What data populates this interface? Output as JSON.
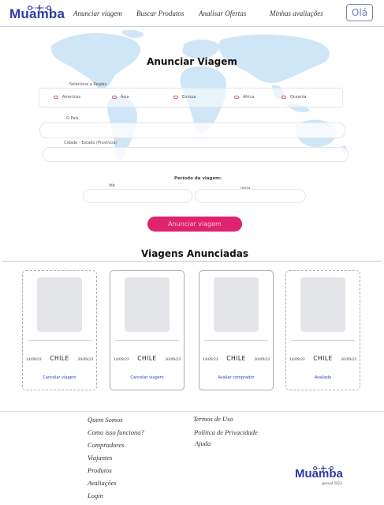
{
  "header": {
    "logo": "Muamba",
    "nav": [
      "Anunciar viagem",
      "Buscar Produtos",
      "Analisar Ofertas",
      "Minhas avaliações"
    ],
    "hello_button": "Olá"
  },
  "form": {
    "title": "Anunciar Viagem",
    "region_label": "Selecione a Região",
    "regions": [
      "Americas",
      "Ásia",
      "Europa",
      "África",
      "Oceania"
    ],
    "country_label": "O País",
    "city_label": "Cidade - Estado (Província)",
    "period_label": "Período da viagem:",
    "departure_label": "Ida",
    "return_label": "Volta",
    "submit": "Anunciar viagem"
  },
  "trips": {
    "title": "Viagens Anunciadas",
    "items": [
      {
        "start": "14/09/23",
        "country": "CHILE",
        "end": "20/09/23",
        "action": "Cancelar viagem"
      },
      {
        "start": "14/09/23",
        "country": "CHILE",
        "end": "20/09/23",
        "action": "Cancelar viagem"
      },
      {
        "start": "14/09/23",
        "country": "CHILE",
        "end": "20/09/23",
        "action": "Avaliar comprador"
      },
      {
        "start": "14/09/23",
        "country": "CHILE",
        "end": "20/09/23",
        "action": "Avaliado"
      }
    ]
  },
  "footer": {
    "col1": [
      "Quem Somos",
      "Como isso funciona?",
      "Compradores",
      "Viajantes",
      "Produtos",
      "Avaliações",
      "Login"
    ],
    "col2": [
      "Termos de Uso",
      "Política de Privacidade",
      "Ajuda"
    ],
    "logo": "Muamba",
    "copyright": "@muaf 2023"
  },
  "colors": {
    "brand": "#2f3aa6",
    "accent": "#e0236f",
    "link": "#2b3bd1",
    "map": "#cfe6f7"
  }
}
